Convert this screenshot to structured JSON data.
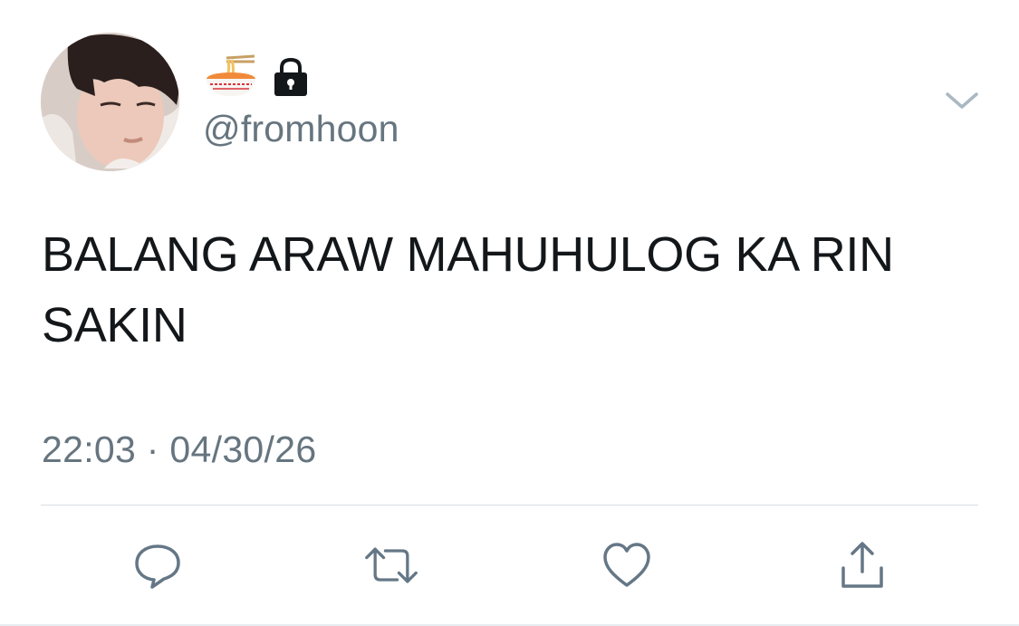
{
  "tweet": {
    "handle": "@fromhoon",
    "name_icons": [
      "ramen-bowl-icon",
      "lock-icon"
    ],
    "text": "BALANG ARAW MAHUHULOG KA RIN SAKIN",
    "timestamp": "22:03 · 04/30/26"
  },
  "actions": [
    "reply-icon",
    "retweet-icon",
    "like-heart-icon",
    "share-icon"
  ],
  "colors": {
    "text": "#14171a",
    "secondary": "#66757f",
    "icon": "#657786",
    "divider": "#d8dee3"
  }
}
